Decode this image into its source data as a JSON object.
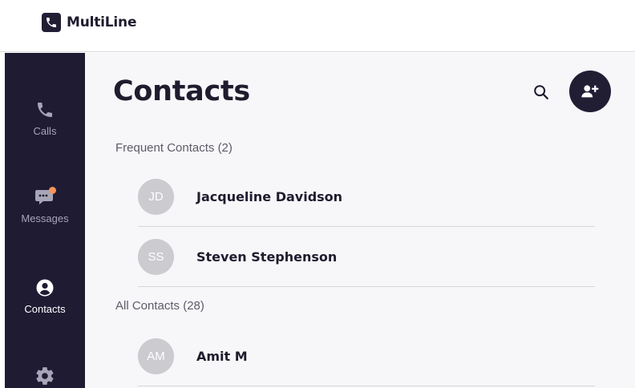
{
  "app": {
    "name": "MultiLine",
    "colors": {
      "dark": "#1f1b33",
      "accent_badge": "#f5955b",
      "avatar_bg": "#cbcbd0",
      "page_bg": "#f7f7f9"
    }
  },
  "sidebar": {
    "items": [
      {
        "label": "Calls",
        "icon": "phone-icon",
        "active": false
      },
      {
        "label": "Messages",
        "icon": "chat-bubble-icon",
        "active": false,
        "badge": true
      },
      {
        "label": "Contacts",
        "icon": "user-circle-icon",
        "active": true
      },
      {
        "label": "",
        "icon": "gear-icon",
        "active": false
      }
    ]
  },
  "main": {
    "title": "Contacts",
    "actions": {
      "search_icon": "search-icon",
      "add_icon": "add-contact-icon"
    },
    "frequent": {
      "header": "Frequent Contacts (2)",
      "contacts": [
        {
          "initials": "JD",
          "name": "Jacqueline Davidson"
        },
        {
          "initials": "SS",
          "name": "Steven Stephenson"
        }
      ]
    },
    "all": {
      "header": "All Contacts (28)",
      "contacts": [
        {
          "initials": "AM",
          "name": "Amit M"
        }
      ]
    }
  }
}
